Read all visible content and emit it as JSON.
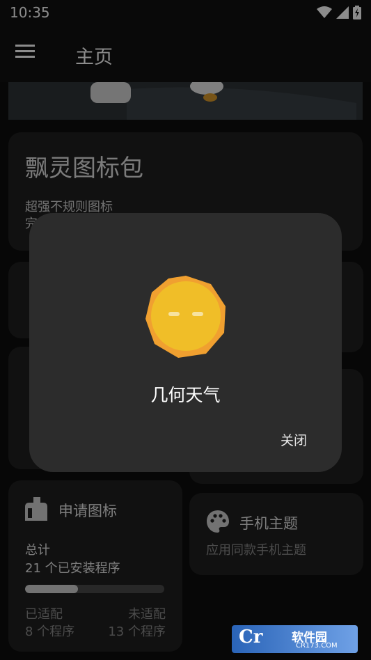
{
  "status_bar": {
    "time": "10:35",
    "icons": [
      "wifi-icon",
      "signal-icon",
      "battery-charging-icon"
    ]
  },
  "app_bar": {
    "menu_icon": "menu-icon",
    "title": "主页"
  },
  "icon_pack": {
    "title": "飘灵图标包",
    "description_line1": "超强不规则图标",
    "description_line2": "完"
  },
  "request_card": {
    "icon": "mailbox-icon",
    "title": "申请图标",
    "total_label": "总计",
    "total_value": "21 个已安装程序",
    "adapted_label": "已适配",
    "adapted_value": "8 个程序",
    "unadapted_label": "未适配",
    "unadapted_value": "13 个程序",
    "progress_fraction": 0.38
  },
  "theme_card": {
    "icon": "palette-icon",
    "title": "手机主题",
    "description": "应用同款手机主题"
  },
  "dialog": {
    "icon": "geometric-weather-icon",
    "title": "几何天气",
    "close_label": "关闭"
  },
  "watermark": {
    "brand": "Cr",
    "name": "软件园",
    "url": "CR173.COM"
  },
  "colors": {
    "background": "#0d0d0d",
    "card": "#202020",
    "dialog": "#2c2c2c",
    "sun_outer": "#f0a030",
    "sun_inner": "#f0be28"
  }
}
